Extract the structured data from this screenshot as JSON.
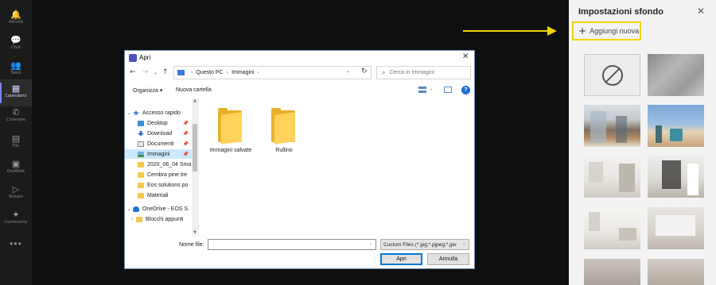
{
  "teams_rail": {
    "items": [
      {
        "icon": "bell-icon",
        "glyph": "🔔",
        "label": "Attività"
      },
      {
        "icon": "chat-icon",
        "glyph": "💬",
        "label": "Chat"
      },
      {
        "icon": "teams-icon",
        "glyph": "👥",
        "label": "Team"
      },
      {
        "icon": "calendar-icon",
        "glyph": "▦",
        "label": "Calendario"
      },
      {
        "icon": "phone-icon",
        "glyph": "✆",
        "label": "Chiamate"
      },
      {
        "icon": "file-icon",
        "glyph": "▤",
        "label": "File"
      },
      {
        "icon": "onenote-icon",
        "glyph": "▣",
        "label": "OneNote"
      },
      {
        "icon": "stream-icon",
        "glyph": "▷",
        "label": "Stream"
      },
      {
        "icon": "community-icon",
        "glyph": "✦",
        "label": "Community"
      }
    ],
    "more": "•••"
  },
  "background_panel": {
    "title": "Impostazioni sfondo",
    "close_glyph": "✕",
    "add_new_label": "Aggiungi nuova",
    "add_glyph": "+"
  },
  "dialog": {
    "title": "Apri",
    "close_glyph": "✕",
    "nav_back": "←",
    "nav_forward": "→",
    "nav_recent": "⌄",
    "nav_up": "↑",
    "breadcrumb": [
      "Questo PC",
      "Immagini"
    ],
    "breadcrumb_sep": "›",
    "refresh_glyph": "↻",
    "search_placeholder": "Cerca in Immagini",
    "search_glyph": "⌕",
    "organize_label": "Organizza ▾",
    "new_folder_label": "Nuova cartella",
    "help_glyph": "?",
    "nav_tree": [
      {
        "label": "Accesso rapido",
        "icon": "star-icon",
        "chevron": "⌄",
        "pin": false
      },
      {
        "label": "Desktop",
        "icon": "desktop-icon",
        "chevron": "",
        "pin": true
      },
      {
        "label": "Download",
        "icon": "download-icon",
        "chevron": "",
        "pin": true
      },
      {
        "label": "Documenti",
        "icon": "document-icon",
        "chevron": "",
        "pin": true
      },
      {
        "label": "Immagini",
        "icon": "pictures-icon",
        "chevron": "",
        "pin": true,
        "selected": true
      },
      {
        "label": "2020_06_04 Sma",
        "icon": "folder-icon",
        "chevron": "",
        "pin": false
      },
      {
        "label": "Cembra pine tre",
        "icon": "folder-icon",
        "chevron": "",
        "pin": false
      },
      {
        "label": "Eos solutions po",
        "icon": "folder-icon",
        "chevron": "",
        "pin": false
      },
      {
        "label": "Materiali",
        "icon": "folder-icon",
        "chevron": "",
        "pin": false
      },
      {
        "label": "OneDrive - EOS S.",
        "icon": "onedrive-icon",
        "chevron": "⌄",
        "pin": false
      },
      {
        "label": "Blocchi appunti",
        "icon": "folder-icon",
        "chevron": "›",
        "pin": false
      }
    ],
    "pin_glyph": "📌",
    "folders": [
      {
        "label": "Immagini salvate"
      },
      {
        "label": "Rullino"
      }
    ],
    "filename_label": "Nome file:",
    "filename_value": "",
    "filter_value": "Custom Files (*.jpg;*.pjpeg;*.jpe",
    "open_button": "Apri",
    "cancel_button": "Annulla",
    "dropdown_glyph": "⌄"
  },
  "colors": {
    "accent_yellow": "#f0d400",
    "teams_purple": "#7f85f5",
    "folder_yellow": "#ffd25c",
    "windows_blue": "#0078d7"
  }
}
